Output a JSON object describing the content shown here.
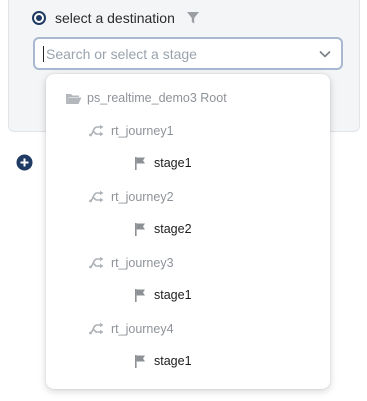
{
  "destination": {
    "radio_label": "select a destination",
    "radio_selected": true,
    "filter_icon": "filter-icon"
  },
  "stage_select": {
    "placeholder": "Search or select a stage",
    "value": "",
    "chevron_icon": "chevron-down-icon"
  },
  "add_icon": "plus-circle-icon",
  "tree": {
    "root": {
      "icon": "folder-open-icon",
      "label": "ps_realtime_demo3 Root"
    },
    "journeys": [
      {
        "icon": "journey-icon",
        "label": "rt_journey1",
        "stage": {
          "icon": "flag-icon",
          "label": "stage1"
        }
      },
      {
        "icon": "journey-icon",
        "label": "rt_journey2",
        "stage": {
          "icon": "flag-icon",
          "label": "stage2"
        }
      },
      {
        "icon": "journey-icon",
        "label": "rt_journey3",
        "stage": {
          "icon": "flag-icon",
          "label": "stage1"
        }
      },
      {
        "icon": "journey-icon",
        "label": "rt_journey4",
        "stage": {
          "icon": "flag-icon",
          "label": "stage1"
        }
      }
    ]
  },
  "colors": {
    "accent": "#1f3a63",
    "select_border": "#a8b8d0",
    "muted_text": "#8e9399",
    "icon_gray": "#9b9fa4"
  }
}
